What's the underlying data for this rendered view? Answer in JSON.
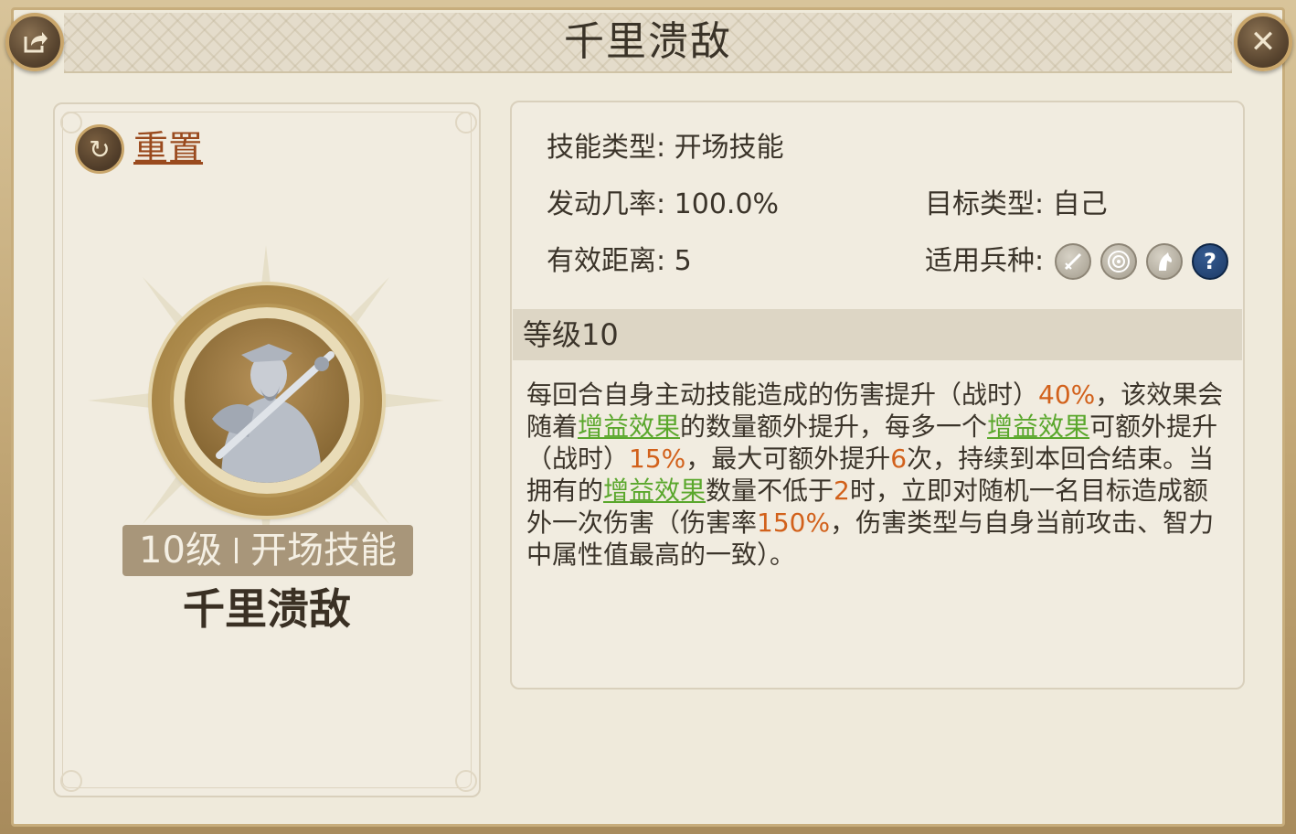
{
  "header": {
    "title": "千里溃敌"
  },
  "left": {
    "reset_label": "重置",
    "level_label": "10级",
    "skill_type_label": "开场技能",
    "skill_name": "千里溃敌"
  },
  "attributes": {
    "skill_type_key": "技能类型:",
    "skill_type_value": "开场技能",
    "trigger_rate_key": "发动几率:",
    "trigger_rate_value": "100.0%",
    "target_type_key": "目标类型:",
    "target_type_value": "自己",
    "range_key": "有效距离:",
    "range_value": "5",
    "unit_types_key": "适用兵种:",
    "unit_icons": [
      "sword-icon",
      "target-icon",
      "horse-icon",
      "question-icon"
    ],
    "unknown_symbol": "?"
  },
  "level_section": {
    "title": "等级10"
  },
  "description": {
    "segments": [
      {
        "t": "每回合自身主动技能造成的伤害提升（战时）",
        "s": "n"
      },
      {
        "t": "40%",
        "s": "h"
      },
      {
        "t": "，该效果会随着",
        "s": "n"
      },
      {
        "t": "增益效果",
        "s": "l"
      },
      {
        "t": "的数量额外提升，每多一个",
        "s": "n"
      },
      {
        "t": "增益效果",
        "s": "l"
      },
      {
        "t": "可额外提升（战时）",
        "s": "n"
      },
      {
        "t": "15%",
        "s": "h"
      },
      {
        "t": "，最大可额外提升",
        "s": "n"
      },
      {
        "t": "6",
        "s": "h"
      },
      {
        "t": "次，持续到本回合结束。当拥有的",
        "s": "n"
      },
      {
        "t": "增益效果",
        "s": "l"
      },
      {
        "t": "数量不低于",
        "s": "n"
      },
      {
        "t": "2",
        "s": "h"
      },
      {
        "t": "时，立即对随机一名目标造成额外一次伤害（伤害率",
        "s": "n"
      },
      {
        "t": "150%",
        "s": "h"
      },
      {
        "t": "，伤害类型与自身当前攻击、智力中属性值最高的一致）。",
        "s": "n"
      }
    ]
  },
  "colors": {
    "highlight": "#d2611b",
    "link": "#5aa72c",
    "reset": "#9a4a1e"
  }
}
